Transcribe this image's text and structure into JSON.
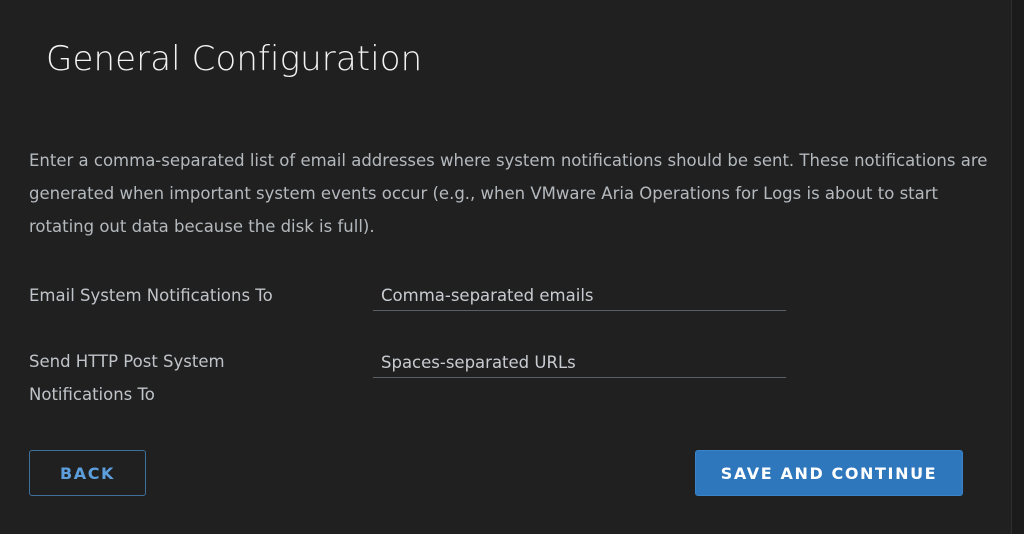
{
  "header": {
    "title": "General Configuration"
  },
  "main": {
    "description": "Enter a comma-separated list of email addresses where system notifications should be sent. These notifications are generated when important system events occur (e.g., when VMware Aria Operations for Logs is about to start rotating out data because the disk is full).",
    "fields": {
      "email": {
        "label": "Email System Notifications To",
        "value": "",
        "placeholder": "Comma-separated emails"
      },
      "http_post": {
        "label": "Send HTTP Post System Notifications To",
        "value": "",
        "placeholder": "Spaces-separated URLs"
      }
    }
  },
  "footer": {
    "back_label": "BACK",
    "save_label": "SAVE AND CONTINUE"
  },
  "colors": {
    "background": "#202021",
    "primary_button": "#2f77bc",
    "outline_button_text": "#5d9fdc"
  }
}
